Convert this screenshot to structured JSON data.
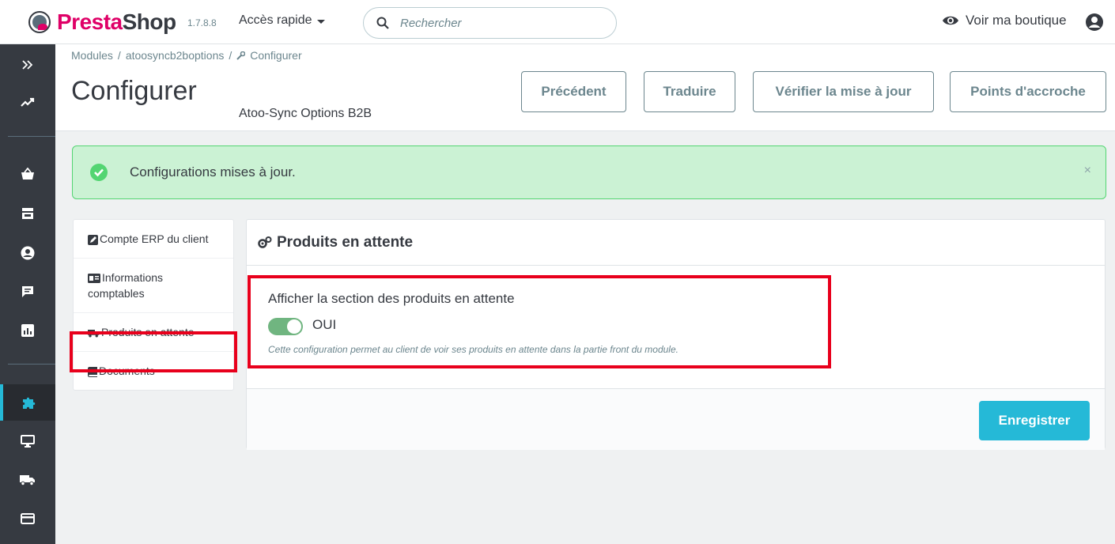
{
  "header": {
    "logo_text_pink": "Presta",
    "logo_text_dark": "Shop",
    "version": "1.7.8.8",
    "quick_access_label": "Accès rapide",
    "search_placeholder": "Rechercher",
    "view_shop_label": "Voir ma boutique"
  },
  "sidebar": {
    "collapse_icon": "double-chevron-right-icon",
    "items": [
      {
        "icon": "trending-up-icon",
        "active": false
      },
      {
        "icon": "shopping-basket-icon",
        "active": false
      },
      {
        "icon": "store-icon",
        "active": false
      },
      {
        "icon": "user-circle-icon",
        "active": false
      },
      {
        "icon": "chat-icon",
        "active": false
      },
      {
        "icon": "bar-chart-icon",
        "active": false
      },
      {
        "icon": "puzzle-icon",
        "active": true
      },
      {
        "icon": "monitor-icon",
        "active": false
      },
      {
        "icon": "truck-icon",
        "active": false
      },
      {
        "icon": "credit-card-icon",
        "active": false
      }
    ]
  },
  "breadcrumb": {
    "items": [
      "Modules",
      "atoosyncb2boptions",
      "Configurer"
    ],
    "separator": "/"
  },
  "page": {
    "title": "Configurer",
    "subtitle": "Atoo-Sync Options B2B"
  },
  "toolbar": {
    "previous_label": "Précédent",
    "translate_label": "Traduire",
    "check_update_label": "Vérifier la mise à jour",
    "hooks_label": "Points d'accroche"
  },
  "alert": {
    "message": "Configurations mises à jour.",
    "close_glyph": "×",
    "color": "#53d572"
  },
  "tabs": [
    {
      "icon": "edit-square-icon",
      "label": "Compte ERP du client"
    },
    {
      "icon": "id-card-icon",
      "label": "Informations comptables"
    },
    {
      "icon": "truck-icon",
      "label": "Produits en attente"
    },
    {
      "icon": "book-icon",
      "label": "Documents"
    }
  ],
  "panel": {
    "title_icon": "gears-icon",
    "title": "Produits en attente",
    "field_label": "Afficher la section des produits en attente",
    "switch_value": "OUI",
    "switch_on": true,
    "help_text": "Cette configuration permet au client de voir ses produits en attente dans la partie front du module.",
    "save_label": "Enregistrer"
  },
  "colors": {
    "brand_pink": "#df0067",
    "accent": "#25b9d7",
    "sidebar_bg": "#363a41",
    "highlight_red": "#e8001c",
    "switch_green": "#70b580"
  }
}
